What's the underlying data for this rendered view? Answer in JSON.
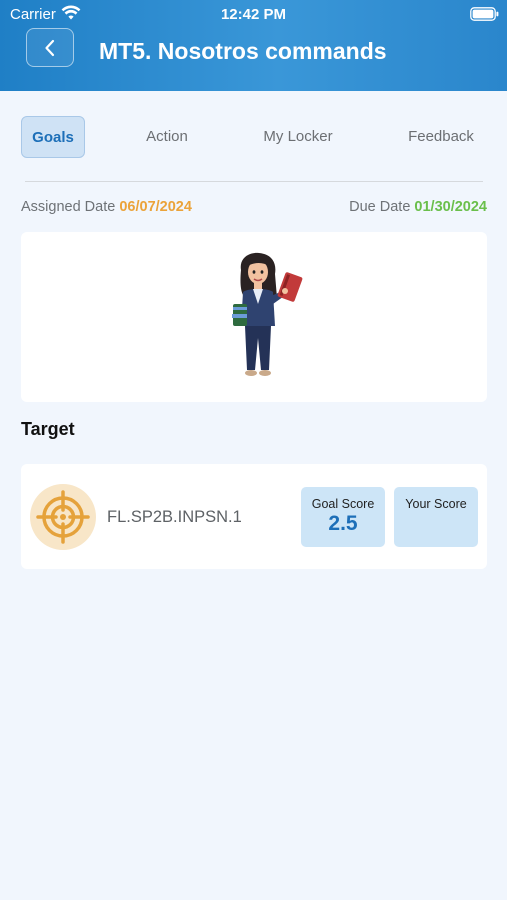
{
  "status_bar": {
    "carrier": "Carrier",
    "time": "12:42 PM"
  },
  "header": {
    "title": "MT5. Nosotros commands",
    "back_icon": "chevron-left-icon"
  },
  "tabs": [
    {
      "label": "Goals",
      "active": true
    },
    {
      "label": "Action",
      "active": false
    },
    {
      "label": "My Locker",
      "active": false
    },
    {
      "label": "Feedback",
      "active": false
    }
  ],
  "dates": {
    "assigned_label": "Assigned Date",
    "assigned_value": "06/07/2024",
    "due_label": "Due Date",
    "due_value": "01/30/2024"
  },
  "section": {
    "target_title": "Target"
  },
  "target": {
    "icon": "target-icon",
    "code": "FL.SP2B.INPSN.1",
    "goal_score_label": "Goal Score",
    "goal_score_value": "2.5",
    "your_score_label": "Your Score",
    "your_score_value": ""
  },
  "colors": {
    "header_blue": "#2a8ad0",
    "accent_blue": "#1d6fb8",
    "assigned_orange": "#eba33a",
    "due_green": "#6abf4b",
    "target_gold": "#e5a23b"
  }
}
